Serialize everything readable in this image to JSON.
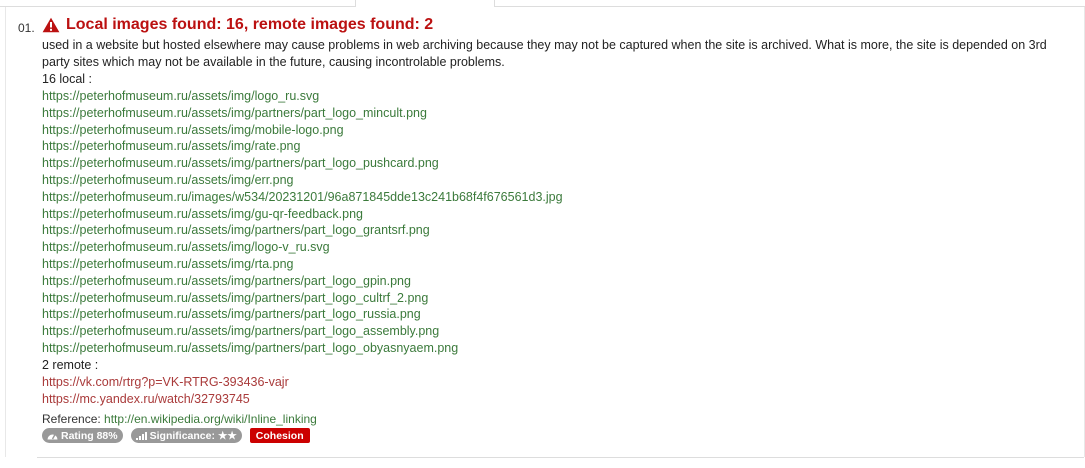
{
  "item": {
    "number": "01.",
    "title": "Local images found: 16, remote images found: 2",
    "description": "used in a website but hosted elsewhere may cause problems in web archiving because they may not be captured when the site is archived. What is more, the site is depended on 3rd party sites which may not be available in the future, causing incontrolable problems.",
    "local_label": "16 local :",
    "local_links": [
      "https://peterhofmuseum.ru/assets/img/logo_ru.svg",
      "https://peterhofmuseum.ru/assets/img/partners/part_logo_mincult.png",
      "https://peterhofmuseum.ru/assets/img/mobile-logo.png",
      "https://peterhofmuseum.ru/assets/img/rate.png",
      "https://peterhofmuseum.ru/assets/img/partners/part_logo_pushcard.png",
      "https://peterhofmuseum.ru/assets/img/err.png",
      "https://peterhofmuseum.ru/images/w534/20231201/96a871845dde13c241b68f4f676561d3.jpg",
      "https://peterhofmuseum.ru/assets/img/gu-qr-feedback.png",
      "https://peterhofmuseum.ru/assets/img/partners/part_logo_grantsrf.png",
      "https://peterhofmuseum.ru/assets/img/logo-v_ru.svg",
      "https://peterhofmuseum.ru/assets/img/rta.png",
      "https://peterhofmuseum.ru/assets/img/partners/part_logo_gpin.png",
      "https://peterhofmuseum.ru/assets/img/partners/part_logo_cultrf_2.png",
      "https://peterhofmuseum.ru/assets/img/partners/part_logo_russia.png",
      "https://peterhofmuseum.ru/assets/img/partners/part_logo_assembly.png",
      "https://peterhofmuseum.ru/assets/img/partners/part_logo_obyasnyaem.png"
    ],
    "remote_label": "2 remote :",
    "remote_links": [
      "https://vk.com/rtrg?p=VK-RTRG-393436-vajr",
      "https://mc.yandex.ru/watch/32793745"
    ],
    "reference_label": "Reference:",
    "reference_link": "http://en.wikipedia.org/wiki/Inline_linking",
    "badges": {
      "rating": "Rating 88%",
      "significance": "Significance:",
      "significance_stars": "★★",
      "category": "Cohesion"
    }
  },
  "colors": {
    "title_red": "#bb1111",
    "local_link_green": "#3b7a3b",
    "remote_link_red": "#a93a3a",
    "badge_gray": "#999999",
    "badge_red": "#cc0000"
  },
  "icons": [
    "warning-icon",
    "dashboard-icon",
    "signal-icon",
    "star-icon"
  ]
}
